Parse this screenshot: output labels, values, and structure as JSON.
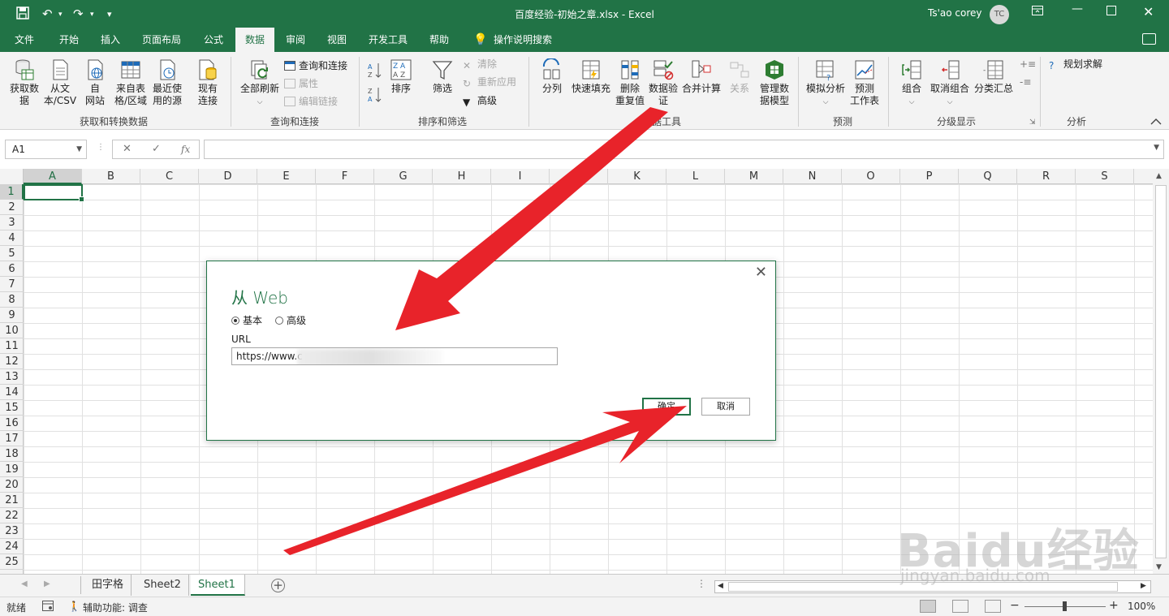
{
  "titlebar": {
    "doc_title": "百度经验-初始之章.xlsx  -  Excel",
    "user_name": "Ts'ao corey",
    "avatar_initials": "TC"
  },
  "menu": {
    "tabs": [
      "文件",
      "开始",
      "插入",
      "页面布局",
      "公式",
      "数据",
      "审阅",
      "视图",
      "开发工具",
      "帮助"
    ],
    "active_tab": "数据",
    "tell_me": "操作说明搜索"
  },
  "ribbon": {
    "get_transform": {
      "label": "获取和转换数据",
      "buttons": [
        "获取数\n据",
        "从文\n本/CSV",
        "自\n网站",
        "来自表\n格/区域",
        "最近使\n用的源",
        "现有\n连接"
      ]
    },
    "queries": {
      "label": "查询和连接",
      "refresh_all": "全部刷新",
      "items": [
        "查询和连接",
        "属性",
        "编辑链接"
      ]
    },
    "sort_filter": {
      "label": "排序和筛选",
      "sort": "排序",
      "filter": "筛选",
      "items": [
        "清除",
        "重新应用",
        "高级"
      ]
    },
    "data_tools": {
      "label": "数据工具",
      "buttons": [
        "分列",
        "快速填充",
        "删除\n重复值",
        "数据验\n证",
        "合并计算",
        "关系",
        "管理数\n据模型"
      ]
    },
    "forecast": {
      "label": "预测",
      "buttons": [
        "模拟分析",
        "预测\n工作表"
      ]
    },
    "outline": {
      "label": "分级显示",
      "buttons": [
        "组合",
        "取消组合",
        "分类汇总"
      ]
    },
    "analysis": {
      "label": "分析",
      "solver": "规划求解"
    }
  },
  "formula_bar": {
    "name_box": "A1",
    "fx": "fx",
    "value": ""
  },
  "grid": {
    "columns": [
      "A",
      "B",
      "C",
      "D",
      "E",
      "F",
      "G",
      "H",
      "I",
      "J",
      "K",
      "L",
      "M",
      "N",
      "O",
      "P",
      "Q",
      "R",
      "S"
    ],
    "rows": [
      "1",
      "2",
      "3",
      "4",
      "5",
      "6",
      "7",
      "8",
      "9",
      "10",
      "11",
      "12",
      "13",
      "14",
      "15",
      "16",
      "17",
      "18",
      "19",
      "20",
      "21",
      "22",
      "23",
      "24",
      "25"
    ],
    "active_cell": "A1"
  },
  "dialog": {
    "title": "从 Web",
    "radio_basic": "基本",
    "radio_advanced": "高级",
    "url_label": "URL",
    "url_value": "https://www.c",
    "ok": "确定",
    "cancel": "取消"
  },
  "sheets": {
    "tabs": [
      "田字格",
      "Sheet2",
      "Sheet1"
    ],
    "active": "Sheet1"
  },
  "status": {
    "ready": "就绪",
    "accessibility": "辅助功能: 调查",
    "zoom": "100%"
  },
  "watermark": {
    "logo": "Baidu经验",
    "url": "jingyan.baidu.com"
  },
  "colors": {
    "excel_green": "#217346",
    "arrow_red": "#e8232a"
  }
}
